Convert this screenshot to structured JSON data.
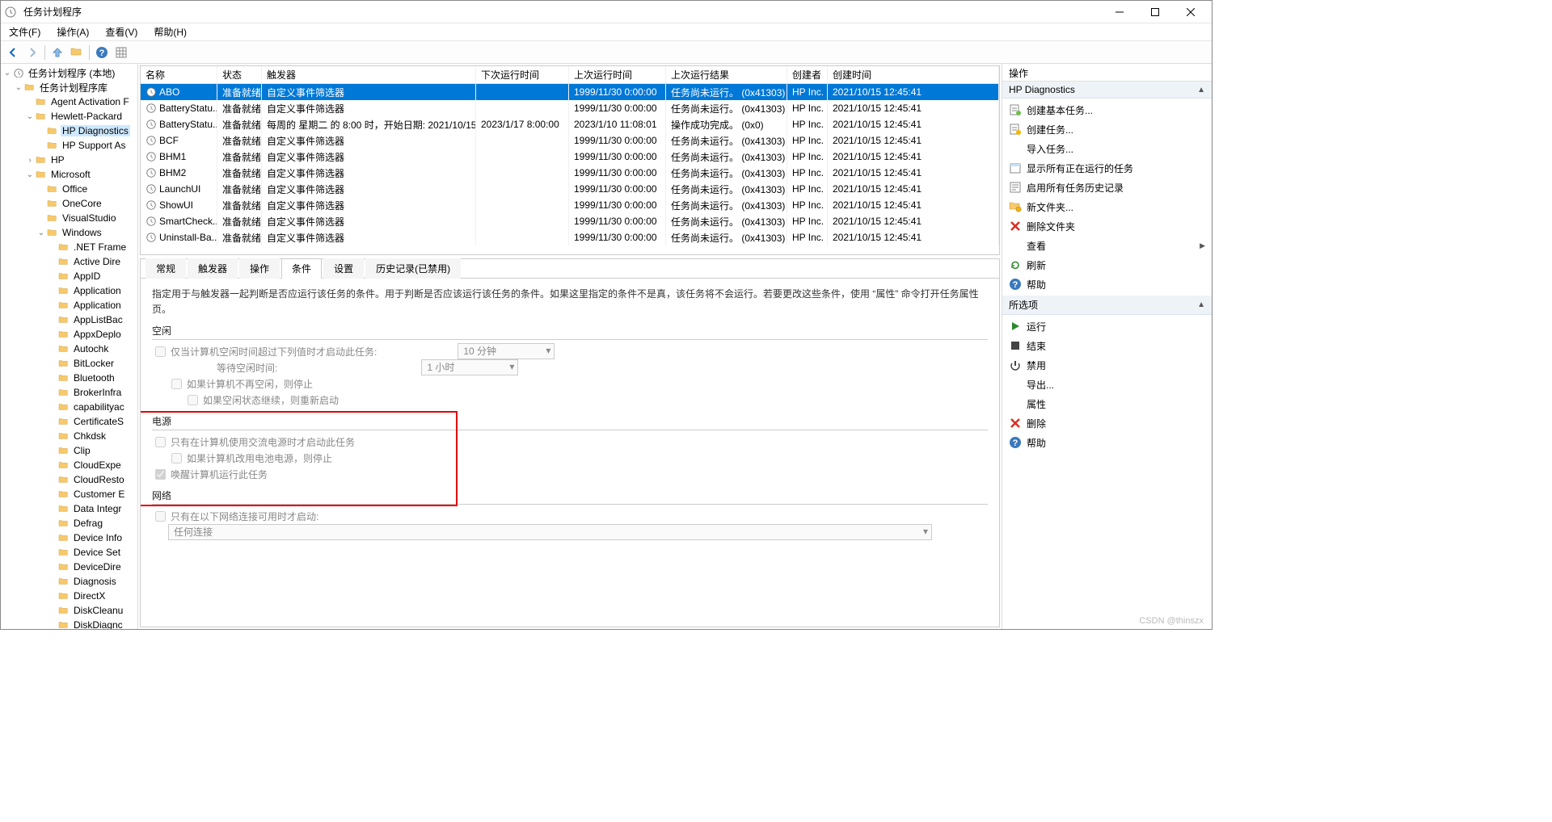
{
  "title": "任务计划程序",
  "menus": [
    "文件(F)",
    "操作(A)",
    "查看(V)",
    "帮助(H)"
  ],
  "tree": [
    {
      "label": "任务计划程序 (本地)",
      "depth": 0,
      "arrow": "down",
      "icon": "clock",
      "sel": false
    },
    {
      "label": "任务计划程序库",
      "depth": 1,
      "arrow": "down",
      "icon": "folder",
      "sel": false
    },
    {
      "label": "Agent Activation F",
      "depth": 2,
      "arrow": "",
      "icon": "folder",
      "sel": false
    },
    {
      "label": "Hewlett-Packard",
      "depth": 2,
      "arrow": "down",
      "icon": "folder",
      "sel": false
    },
    {
      "label": "HP Diagnostics",
      "depth": 3,
      "arrow": "",
      "icon": "folder",
      "sel": true
    },
    {
      "label": "HP Support As",
      "depth": 3,
      "arrow": "",
      "icon": "folder",
      "sel": false
    },
    {
      "label": "HP",
      "depth": 2,
      "arrow": "right",
      "icon": "folder",
      "sel": false
    },
    {
      "label": "Microsoft",
      "depth": 2,
      "arrow": "down",
      "icon": "folder",
      "sel": false
    },
    {
      "label": "Office",
      "depth": 3,
      "arrow": "",
      "icon": "folder",
      "sel": false
    },
    {
      "label": "OneCore",
      "depth": 3,
      "arrow": "",
      "icon": "folder",
      "sel": false
    },
    {
      "label": "VisualStudio",
      "depth": 3,
      "arrow": "",
      "icon": "folder",
      "sel": false
    },
    {
      "label": "Windows",
      "depth": 3,
      "arrow": "down",
      "icon": "folder",
      "sel": false
    },
    {
      "label": ".NET Frame",
      "depth": 4,
      "arrow": "",
      "icon": "folder",
      "sel": false
    },
    {
      "label": "Active Dire",
      "depth": 4,
      "arrow": "",
      "icon": "folder",
      "sel": false
    },
    {
      "label": "AppID",
      "depth": 4,
      "arrow": "",
      "icon": "folder",
      "sel": false
    },
    {
      "label": "Application",
      "depth": 4,
      "arrow": "",
      "icon": "folder",
      "sel": false
    },
    {
      "label": "Application",
      "depth": 4,
      "arrow": "",
      "icon": "folder",
      "sel": false
    },
    {
      "label": "AppListBac",
      "depth": 4,
      "arrow": "",
      "icon": "folder",
      "sel": false
    },
    {
      "label": "AppxDeplo",
      "depth": 4,
      "arrow": "",
      "icon": "folder",
      "sel": false
    },
    {
      "label": "Autochk",
      "depth": 4,
      "arrow": "",
      "icon": "folder",
      "sel": false
    },
    {
      "label": "BitLocker",
      "depth": 4,
      "arrow": "",
      "icon": "folder",
      "sel": false
    },
    {
      "label": "Bluetooth",
      "depth": 4,
      "arrow": "",
      "icon": "folder",
      "sel": false
    },
    {
      "label": "BrokerInfra",
      "depth": 4,
      "arrow": "",
      "icon": "folder",
      "sel": false
    },
    {
      "label": "capabilityac",
      "depth": 4,
      "arrow": "",
      "icon": "folder",
      "sel": false
    },
    {
      "label": "CertificateS",
      "depth": 4,
      "arrow": "",
      "icon": "folder",
      "sel": false
    },
    {
      "label": "Chkdsk",
      "depth": 4,
      "arrow": "",
      "icon": "folder",
      "sel": false
    },
    {
      "label": "Clip",
      "depth": 4,
      "arrow": "",
      "icon": "folder",
      "sel": false
    },
    {
      "label": "CloudExpe",
      "depth": 4,
      "arrow": "",
      "icon": "folder",
      "sel": false
    },
    {
      "label": "CloudResto",
      "depth": 4,
      "arrow": "",
      "icon": "folder",
      "sel": false
    },
    {
      "label": "Customer E",
      "depth": 4,
      "arrow": "",
      "icon": "folder",
      "sel": false
    },
    {
      "label": "Data Integr",
      "depth": 4,
      "arrow": "",
      "icon": "folder",
      "sel": false
    },
    {
      "label": "Defrag",
      "depth": 4,
      "arrow": "",
      "icon": "folder",
      "sel": false
    },
    {
      "label": "Device Info",
      "depth": 4,
      "arrow": "",
      "icon": "folder",
      "sel": false
    },
    {
      "label": "Device Set",
      "depth": 4,
      "arrow": "",
      "icon": "folder",
      "sel": false
    },
    {
      "label": "DeviceDire",
      "depth": 4,
      "arrow": "",
      "icon": "folder",
      "sel": false
    },
    {
      "label": "Diagnosis",
      "depth": 4,
      "arrow": "",
      "icon": "folder",
      "sel": false
    },
    {
      "label": "DirectX",
      "depth": 4,
      "arrow": "",
      "icon": "folder",
      "sel": false
    },
    {
      "label": "DiskCleanu",
      "depth": 4,
      "arrow": "",
      "icon": "folder",
      "sel": false
    },
    {
      "label": "DiskDiagnc",
      "depth": 4,
      "arrow": "",
      "icon": "folder",
      "sel": false
    }
  ],
  "grid": {
    "headers": [
      "名称",
      "状态",
      "触发器",
      "下次运行时间",
      "上次运行时间",
      "上次运行结果",
      "创建者",
      "创建时间"
    ],
    "rows": [
      {
        "sel": true,
        "cells": [
          "ABO",
          "准备就绪",
          "自定义事件筛选器",
          "",
          "1999/11/30 0:00:00",
          "任务尚未运行。 (0x41303)",
          "HP Inc.",
          "2021/10/15 12:45:41"
        ]
      },
      {
        "sel": false,
        "cells": [
          "BatteryStatu...",
          "准备就绪",
          "自定义事件筛选器",
          "",
          "1999/11/30 0:00:00",
          "任务尚未运行。 (0x41303)",
          "HP Inc.",
          "2021/10/15 12:45:41"
        ]
      },
      {
        "sel": false,
        "cells": [
          "BatteryStatu...",
          "准备就绪",
          "每周的 星期二 的 8:00 时，开始日期: 2021/10/15",
          "2023/1/17 8:00:00",
          "2023/1/10 11:08:01",
          "操作成功完成。 (0x0)",
          "HP Inc.",
          "2021/10/15 12:45:41"
        ]
      },
      {
        "sel": false,
        "cells": [
          "BCF",
          "准备就绪",
          "自定义事件筛选器",
          "",
          "1999/11/30 0:00:00",
          "任务尚未运行。 (0x41303)",
          "HP Inc.",
          "2021/10/15 12:45:41"
        ]
      },
      {
        "sel": false,
        "cells": [
          "BHM1",
          "准备就绪",
          "自定义事件筛选器",
          "",
          "1999/11/30 0:00:00",
          "任务尚未运行。 (0x41303)",
          "HP Inc.",
          "2021/10/15 12:45:41"
        ]
      },
      {
        "sel": false,
        "cells": [
          "BHM2",
          "准备就绪",
          "自定义事件筛选器",
          "",
          "1999/11/30 0:00:00",
          "任务尚未运行。 (0x41303)",
          "HP Inc.",
          "2021/10/15 12:45:41"
        ]
      },
      {
        "sel": false,
        "cells": [
          "LaunchUI",
          "准备就绪",
          "自定义事件筛选器",
          "",
          "1999/11/30 0:00:00",
          "任务尚未运行。 (0x41303)",
          "HP Inc.",
          "2021/10/15 12:45:41"
        ]
      },
      {
        "sel": false,
        "cells": [
          "ShowUI",
          "准备就绪",
          "自定义事件筛选器",
          "",
          "1999/11/30 0:00:00",
          "任务尚未运行。 (0x41303)",
          "HP Inc.",
          "2021/10/15 12:45:41"
        ]
      },
      {
        "sel": false,
        "cells": [
          "SmartCheck...",
          "准备就绪",
          "自定义事件筛选器",
          "",
          "1999/11/30 0:00:00",
          "任务尚未运行。 (0x41303)",
          "HP Inc.",
          "2021/10/15 12:45:41"
        ]
      },
      {
        "sel": false,
        "cells": [
          "Uninstall-Ba...",
          "准备就绪",
          "自定义事件筛选器",
          "",
          "1999/11/30 0:00:00",
          "任务尚未运行。 (0x41303)",
          "HP Inc.",
          "2021/10/15 12:45:41"
        ]
      }
    ]
  },
  "detail": {
    "tabs": [
      "常规",
      "触发器",
      "操作",
      "条件",
      "设置",
      "历史记录(已禁用)"
    ],
    "active_tab": 3,
    "desc": "指定用于与触发器一起判断是否应运行该任务的条件。用于判断是否应该运行该任务的条件。如果这里指定的条件不是真，该任务将不会运行。若要更改这些条件，使用 “属性” 命令打开任务属性页。",
    "idle_title": "空闲",
    "idle_check": "仅当计算机空闲时间超过下列值时才启动此任务:",
    "idle_wait_label": "等待空闲时间:",
    "idle_duration": "10 分钟",
    "idle_wait": "1 小时",
    "idle_stop": "如果计算机不再空闲，则停止",
    "idle_restart": "如果空闲状态继续，则重新启动",
    "power_title": "电源",
    "power_ac": "只有在计算机使用交流电源时才启动此任务",
    "power_battery": "如果计算机改用电池电源，则停止",
    "power_wake": "唤醒计算机运行此任务",
    "net_title": "网络",
    "net_check": "只有在以下网络连接可用时才启动:",
    "net_combo": "任何连接"
  },
  "actions_title": "操作",
  "group1_title": "HP Diagnostics",
  "group1_items": [
    {
      "label": "创建基本任务...",
      "icon": "task-green"
    },
    {
      "label": "创建任务...",
      "icon": "task-yellow"
    },
    {
      "label": "导入任务...",
      "icon": "none"
    },
    {
      "label": "显示所有正在运行的任务",
      "icon": "calendar"
    },
    {
      "label": "启用所有任务历史记录",
      "icon": "history"
    },
    {
      "label": "新文件夹...",
      "icon": "folder-new"
    },
    {
      "label": "删除文件夹",
      "icon": "delete"
    },
    {
      "label": "查看",
      "icon": "none",
      "arrow": true
    },
    {
      "label": "刷新",
      "icon": "refresh"
    },
    {
      "label": "帮助",
      "icon": "help"
    }
  ],
  "group2_title": "所选项",
  "group2_items": [
    {
      "label": "运行",
      "icon": "play"
    },
    {
      "label": "结束",
      "icon": "stop"
    },
    {
      "label": "禁用",
      "icon": "disable"
    },
    {
      "label": "导出...",
      "icon": "none"
    },
    {
      "label": "属性",
      "icon": "none"
    },
    {
      "label": "删除",
      "icon": "delete"
    },
    {
      "label": "帮助",
      "icon": "help"
    }
  ],
  "watermark": "CSDN @thinszx"
}
